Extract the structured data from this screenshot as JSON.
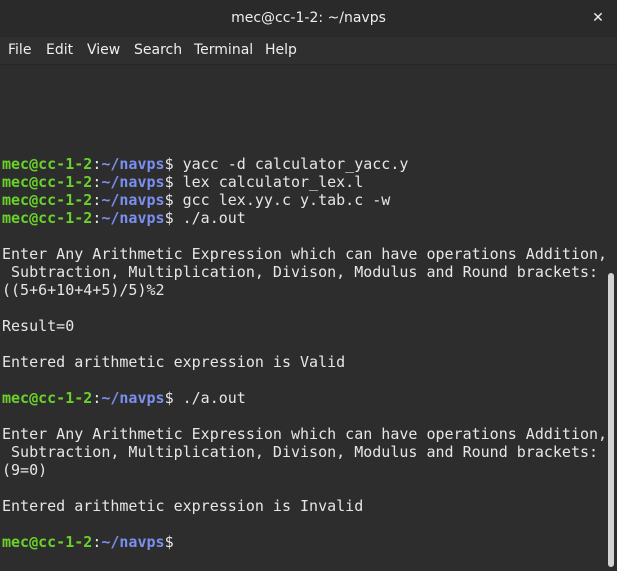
{
  "window": {
    "title": "mec@cc-1-2: ~/navps",
    "close_glyph": "✕"
  },
  "menu": {
    "items": [
      "File",
      "Edit",
      "View",
      "Search",
      "Terminal",
      "Help"
    ]
  },
  "prompt": {
    "user_host": "mec@cc-1-2",
    "colon": ":",
    "path": "~/navps",
    "symbol": "$"
  },
  "terminal": {
    "lines": [
      {
        "type": "cmd",
        "text": " yacc -d calculator_yacc.y"
      },
      {
        "type": "cmd",
        "text": " lex calculator_lex.l"
      },
      {
        "type": "cmd",
        "text": " gcc lex.yy.c y.tab.c -w"
      },
      {
        "type": "cmd",
        "text": " ./a.out"
      },
      {
        "type": "out",
        "text": ""
      },
      {
        "type": "out",
        "text": "Enter Any Arithmetic Expression which can have operations Addition,"
      },
      {
        "type": "out",
        "text": " Subtraction, Multiplication, Divison, Modulus and Round brackets:"
      },
      {
        "type": "out",
        "text": "((5+6+10+4+5)/5)%2"
      },
      {
        "type": "out",
        "text": ""
      },
      {
        "type": "out",
        "text": "Result=0"
      },
      {
        "type": "out",
        "text": ""
      },
      {
        "type": "out",
        "text": "Entered arithmetic expression is Valid"
      },
      {
        "type": "out",
        "text": ""
      },
      {
        "type": "cmd",
        "text": " ./a.out"
      },
      {
        "type": "out",
        "text": ""
      },
      {
        "type": "out",
        "text": "Enter Any Arithmetic Expression which can have operations Addition,"
      },
      {
        "type": "out",
        "text": " Subtraction, Multiplication, Divison, Modulus and Round brackets:"
      },
      {
        "type": "out",
        "text": "(9=0)"
      },
      {
        "type": "out",
        "text": ""
      },
      {
        "type": "out",
        "text": "Entered arithmetic expression is Invalid"
      },
      {
        "type": "out",
        "text": ""
      },
      {
        "type": "cmd",
        "text": ""
      }
    ]
  },
  "colors": {
    "prompt_user": "#6ad22a",
    "prompt_path": "#7b8ff0",
    "text": "#e6e6e6",
    "background": "#2d2d2d"
  }
}
